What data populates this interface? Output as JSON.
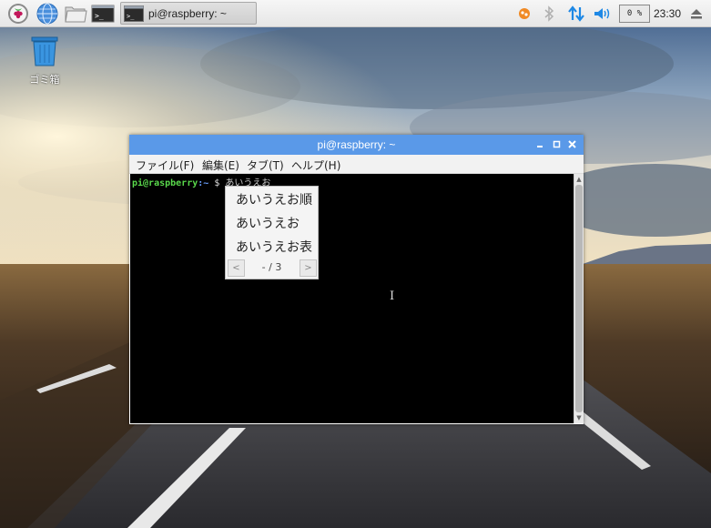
{
  "taskbar": {
    "task_button_label": "pi@raspberry: ~",
    "tray": {
      "cpu_label": "0 %",
      "clock": "23:30"
    },
    "icons": [
      "raspberry-menu-icon",
      "web-browser-icon",
      "file-manager-icon",
      "terminal-icon"
    ]
  },
  "desktop": {
    "trash_label": "ゴミ箱"
  },
  "window": {
    "title": "pi@raspberry: ~",
    "controls": [
      "minimize-icon",
      "maximize-icon",
      "close-icon"
    ],
    "menu": [
      "ファイル(F)",
      "編集(E)",
      "タブ(T)",
      "ヘルプ(H)"
    ]
  },
  "terminal": {
    "prompt_user": "pi@raspberry",
    "prompt_path": ":~",
    "prompt_symbol": " $ ",
    "typed_text": "あいうえお"
  },
  "ime": {
    "candidates": [
      "あいうえお順",
      "あいうえお",
      "あいうえお表"
    ],
    "page_label": "- / 3",
    "prev_label": "<",
    "next_label": ">"
  },
  "colors": {
    "titlebar": "#5a99e8",
    "taskbar": "#eeeeee",
    "terminal_bg": "#000000",
    "prompt_user": "#5ad94c",
    "prompt_path": "#6aa0ff"
  }
}
